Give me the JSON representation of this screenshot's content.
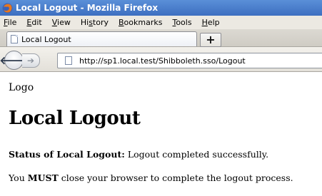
{
  "window": {
    "title": "Local Logout - Mozilla Firefox",
    "icon": "firefox-icon"
  },
  "menu": [
    {
      "label": "File",
      "accel": "F",
      "rest": "ile"
    },
    {
      "label": "Edit",
      "accel": "E",
      "rest": "dit"
    },
    {
      "label": "View",
      "accel": "V",
      "rest": "iew"
    },
    {
      "label": "History",
      "pre": "Hi",
      "accel": "s",
      "rest": "tory"
    },
    {
      "label": "Bookmarks",
      "accel": "B",
      "rest": "ookmarks"
    },
    {
      "label": "Tools",
      "accel": "T",
      "rest": "ools"
    },
    {
      "label": "Help",
      "accel": "H",
      "rest": "elp"
    }
  ],
  "tab": {
    "label": "Local Logout",
    "new_tab_label": "+"
  },
  "nav": {
    "back_glyph": "🡐",
    "forward_glyph": "➔",
    "url": "http://sp1.local.test/Shibboleth.sso/Logout"
  },
  "page": {
    "logo_text": "Logo",
    "heading": "Local Logout",
    "status_label": "Status of Local Logout:",
    "status_text": "Logout completed successfully.",
    "must_prefix": "You",
    "must_word": "MUST",
    "must_suffix": "close your browser to complete the logout process."
  }
}
